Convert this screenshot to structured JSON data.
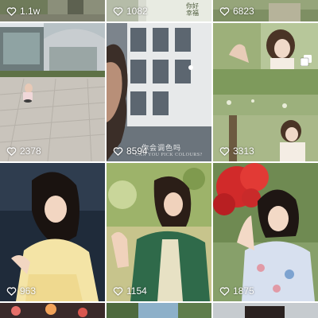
{
  "feed": {
    "posts": [
      {
        "likes": "1.1w",
        "photo": "street-scene"
      },
      {
        "likes": "1082",
        "photo": "storefront"
      },
      {
        "likes": "6823",
        "photo": "portrait"
      },
      {
        "likes": "2378",
        "photo": "plaza-with-child"
      },
      {
        "likes": "8594",
        "photo": "movie-still",
        "caption": "你会调色吗",
        "subcaption": "CAN YOU PICK COLOURS?"
      },
      {
        "likes": "3313",
        "photo": "forest-portraits-collage",
        "multi_photo": true
      },
      {
        "likes": "963",
        "photo": "portrait-yellow-dress"
      },
      {
        "likes": "1154",
        "photo": "portrait-green-kimono"
      },
      {
        "likes": "1875",
        "photo": "portrait-red-flowers"
      },
      {
        "likes": "",
        "photo": "fireworks"
      },
      {
        "likes": "",
        "photo": "sky-trees"
      },
      {
        "likes": "",
        "photo": "portrait"
      }
    ],
    "storefront_sign": "你好\n幸福"
  },
  "icons": {
    "like": "heart-outline-icon",
    "multi": "multiple-photos-icon"
  },
  "colors": {
    "text_on_image": "#ffffff",
    "background": "#ffffff"
  }
}
